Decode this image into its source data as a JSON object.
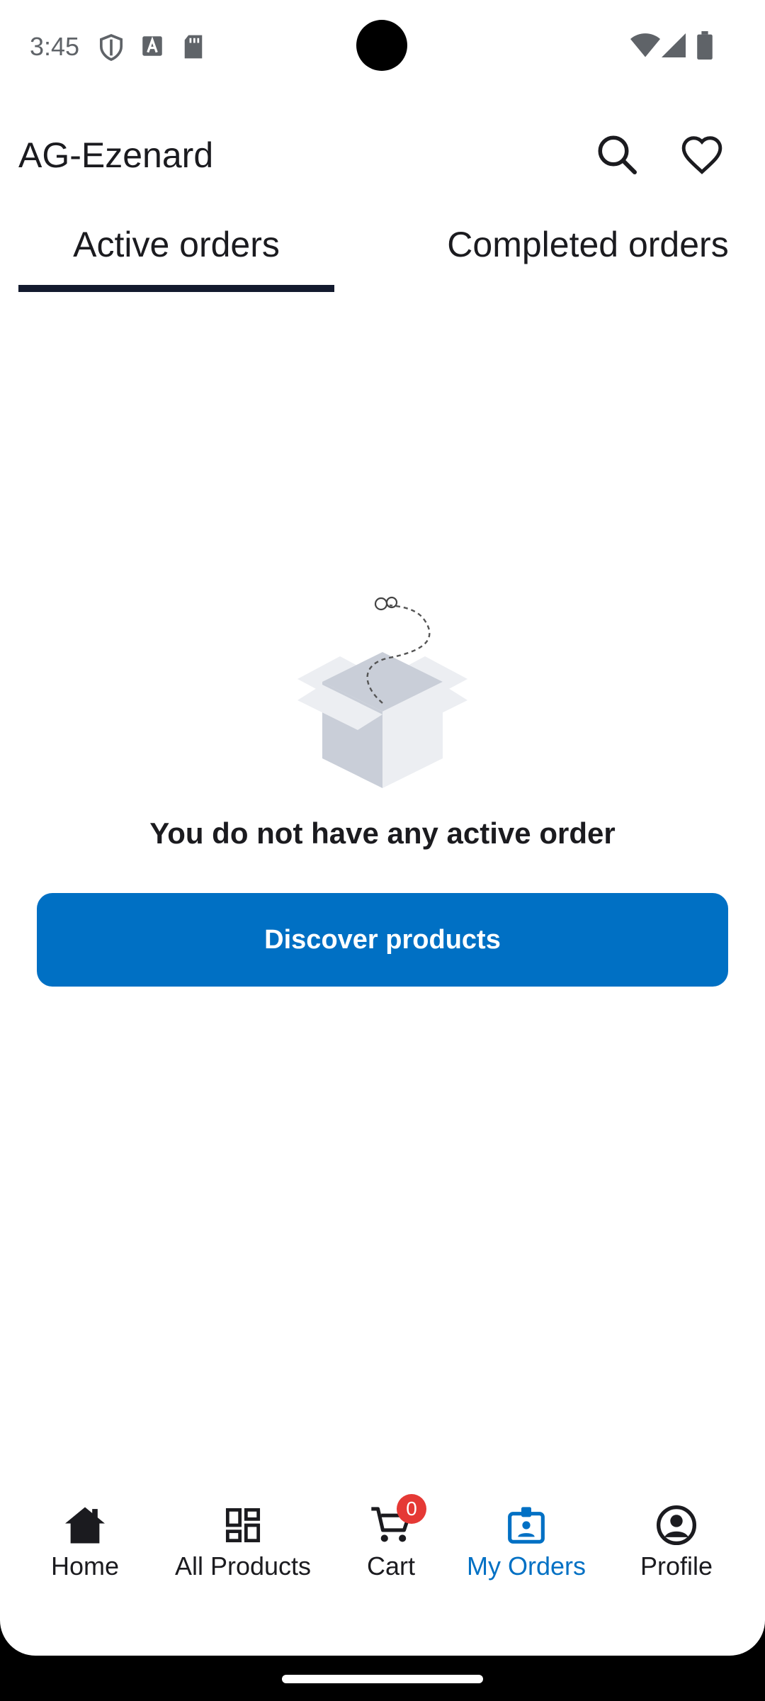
{
  "status_bar": {
    "time": "3:45",
    "icons": [
      "shield-icon",
      "a-badge-icon",
      "sd-card-icon",
      "wifi-icon",
      "signal-icon",
      "battery-icon"
    ]
  },
  "app_bar": {
    "title": "AG-Ezenard",
    "actions": [
      "search-icon",
      "heart-icon"
    ]
  },
  "tabs": [
    {
      "label": "Active orders",
      "selected": true
    },
    {
      "label": "Completed orders",
      "selected": false
    }
  ],
  "empty_state": {
    "illustration": "empty-box-icon",
    "message": "You do not have any active order",
    "button_label": "Discover products"
  },
  "bottom_nav": {
    "items": [
      {
        "label": "Home",
        "icon": "home-icon"
      },
      {
        "label": "All Products",
        "icon": "grid-icon"
      },
      {
        "label": "Cart",
        "icon": "cart-icon",
        "badge": "0"
      },
      {
        "label": "My Orders",
        "icon": "orders-icon",
        "active": true
      },
      {
        "label": "Profile",
        "icon": "profile-icon"
      }
    ]
  },
  "colors": {
    "primary": "#0070c4",
    "tab_indicator": "#131a2e",
    "badge": "#e53935",
    "text": "#1b1b1f"
  }
}
